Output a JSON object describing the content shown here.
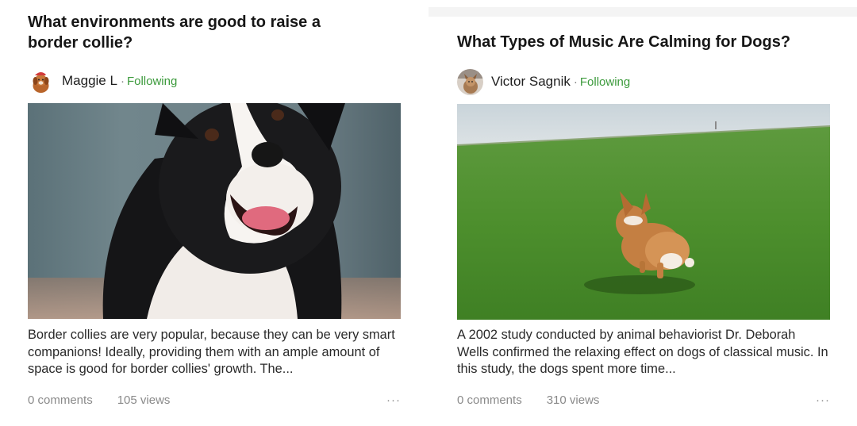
{
  "cards": [
    {
      "title": "What environments are good to raise a border collie?",
      "author": {
        "name": "Maggie  L",
        "avatar_icon": "dog-avatar-icon"
      },
      "separator": "·",
      "follow_status": "Following",
      "image": "border-collie-photo",
      "excerpt": "Border collies are very popular, because they can be very smart companions! Ideally, providing them with an ample amount of space is good for border collies' growth. The...",
      "comments": "0 comments",
      "views": "105 views",
      "more_icon": "···"
    },
    {
      "title": "What Types of Music Are Calming for Dogs?",
      "author": {
        "name": "Victor Sagnik",
        "avatar_icon": "dog-avatar-icon"
      },
      "separator": "·",
      "follow_status": "Following",
      "image": "corgi-on-grass-photo",
      "excerpt": "A 2002 study conducted by animal behaviorist Dr. Deborah Wells confirmed the relaxing effect on dogs of classical music. In this study, the dogs spent more time...",
      "comments": "0 comments",
      "views": "310 views",
      "more_icon": "···"
    }
  ],
  "colors": {
    "follow_green": "#3b9a3b",
    "meta_gray": "#8a8a8a"
  }
}
